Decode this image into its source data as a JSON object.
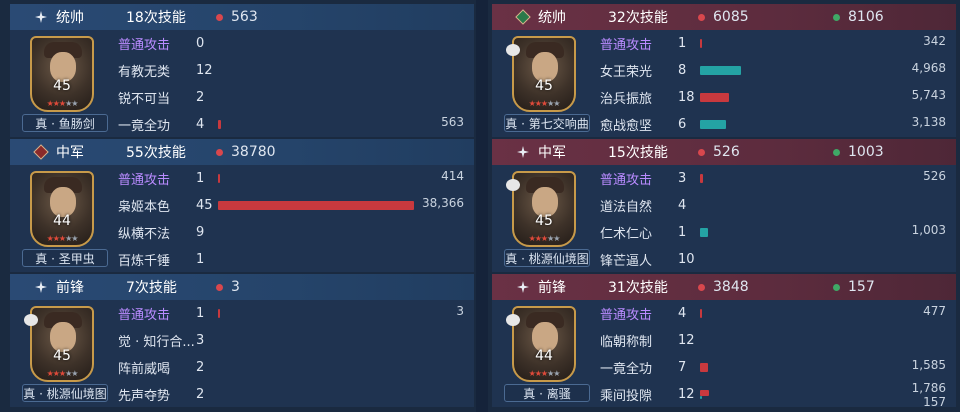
{
  "groups": [
    {
      "side": "left",
      "role": "统帅",
      "skills": "18次技能",
      "damage": "563",
      "heal": "",
      "level": "45",
      "title": "真 · 鱼肠剑",
      "rows": [
        {
          "name": "普通攻击",
          "count": "0",
          "damage": 0,
          "damage_label": "",
          "heal": 0,
          "heal_label": ""
        },
        {
          "name": "有教无类",
          "count": "12",
          "damage": 0,
          "damage_label": "",
          "heal": 0,
          "heal_label": ""
        },
        {
          "name": "锐不可当",
          "count": "2",
          "damage": 0,
          "damage_label": "",
          "heal": 0,
          "heal_label": ""
        },
        {
          "name": "一竟全功",
          "count": "4",
          "damage": 563,
          "damage_label": "563",
          "heal": 0,
          "heal_label": ""
        }
      ]
    },
    {
      "side": "left",
      "role": "中军",
      "skills": "55次技能",
      "damage": "38780",
      "heal": "",
      "level": "44",
      "title": "真 · 圣甲虫",
      "rows": [
        {
          "name": "普通攻击",
          "count": "1",
          "damage": 414,
          "damage_label": "414",
          "heal": 0,
          "heal_label": ""
        },
        {
          "name": "枭姬本色",
          "count": "45",
          "damage": 38366,
          "damage_label": "38,366",
          "heal": 0,
          "heal_label": ""
        },
        {
          "name": "纵横不法",
          "count": "9",
          "damage": 0,
          "damage_label": "",
          "heal": 0,
          "heal_label": ""
        },
        {
          "name": "百炼千锤",
          "count": "1",
          "damage": 0,
          "damage_label": "",
          "heal": 0,
          "heal_label": ""
        }
      ]
    },
    {
      "side": "left",
      "role": "前锋",
      "skills": "7次技能",
      "damage": "3",
      "heal": "",
      "level": "45",
      "title": "真 · 桃源仙境图",
      "rows": [
        {
          "name": "普通攻击",
          "count": "1",
          "damage": 3,
          "damage_label": "3",
          "heal": 0,
          "heal_label": ""
        },
        {
          "name": "觉 · 知行合...",
          "count": "3",
          "damage": 0,
          "damage_label": "",
          "heal": 0,
          "heal_label": ""
        },
        {
          "name": "阵前威喝",
          "count": "2",
          "damage": 0,
          "damage_label": "",
          "heal": 0,
          "heal_label": ""
        },
        {
          "name": "先声夺势",
          "count": "2",
          "damage": 0,
          "damage_label": "",
          "heal": 0,
          "heal_label": ""
        }
      ]
    },
    {
      "side": "right",
      "role": "统帅",
      "skills": "32次技能",
      "damage": "6085",
      "heal": "8106",
      "level": "45",
      "title": "真 · 第七交响曲",
      "rows": [
        {
          "name": "普通攻击",
          "count": "1",
          "damage": 342,
          "damage_label": "342",
          "heal": 0,
          "heal_label": ""
        },
        {
          "name": "女王荣光",
          "count": "8",
          "damage": 0,
          "damage_label": "",
          "heal": 4968,
          "heal_label": "4,968"
        },
        {
          "name": "治兵振旅",
          "count": "18",
          "damage": 5743,
          "damage_label": "5,743",
          "heal": 0,
          "heal_label": ""
        },
        {
          "name": "愈战愈坚",
          "count": "6",
          "damage": 0,
          "damage_label": "",
          "heal": 3138,
          "heal_label": "3,138"
        }
      ]
    },
    {
      "side": "right",
      "role": "中军",
      "skills": "15次技能",
      "damage": "526",
      "heal": "1003",
      "level": "45",
      "title": "真 · 桃源仙境图",
      "rows": [
        {
          "name": "普通攻击",
          "count": "3",
          "damage": 526,
          "damage_label": "526",
          "heal": 0,
          "heal_label": ""
        },
        {
          "name": "道法自然",
          "count": "4",
          "damage": 0,
          "damage_label": "",
          "heal": 0,
          "heal_label": ""
        },
        {
          "name": "仁术仁心",
          "count": "1",
          "damage": 0,
          "damage_label": "",
          "heal": 1003,
          "heal_label": "1,003"
        },
        {
          "name": "锋芒逼人",
          "count": "10",
          "damage": 0,
          "damage_label": "",
          "heal": 0,
          "heal_label": ""
        }
      ]
    },
    {
      "side": "right",
      "role": "前锋",
      "skills": "31次技能",
      "damage": "3848",
      "heal": "157",
      "level": "44",
      "title": "真 · 离骚",
      "rows": [
        {
          "name": "普通攻击",
          "count": "4",
          "damage": 477,
          "damage_label": "477",
          "heal": 0,
          "heal_label": ""
        },
        {
          "name": "临朝称制",
          "count": "12",
          "damage": 0,
          "damage_label": "",
          "heal": 0,
          "heal_label": ""
        },
        {
          "name": "一竟全功",
          "count": "7",
          "damage": 1585,
          "damage_label": "1,585",
          "heal": 0,
          "heal_label": ""
        },
        {
          "name": "乘间投隙",
          "count": "12",
          "damage": 1786,
          "damage_label": "1,786",
          "heal": 157,
          "heal_label": "157"
        }
      ]
    }
  ],
  "scale_max": 38366,
  "colors": {
    "damage": "#c8393e",
    "heal": "#24a3a4",
    "normal_attack": "#b98bff"
  }
}
